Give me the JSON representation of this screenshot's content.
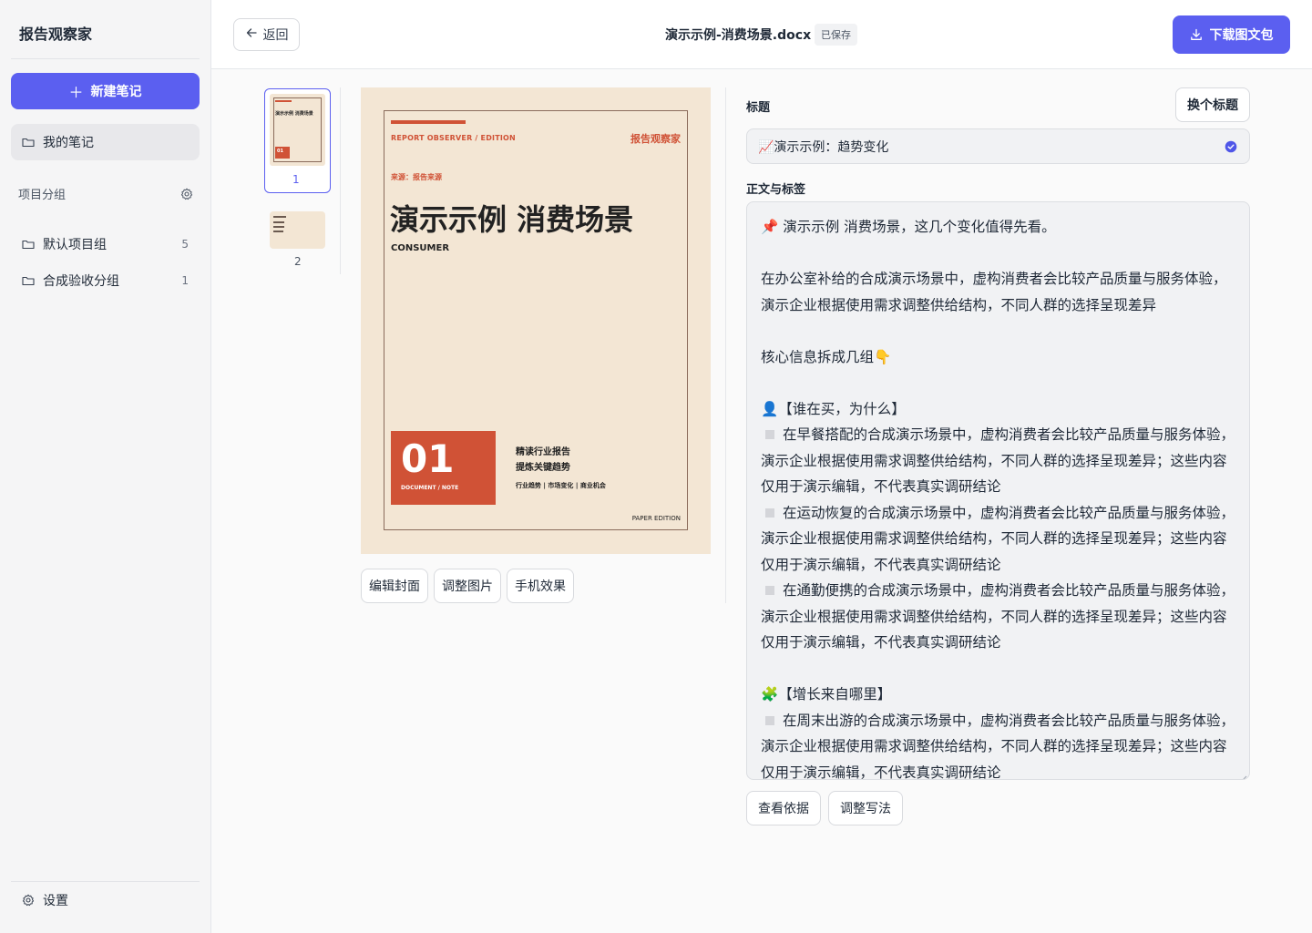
{
  "sidebar": {
    "brand": "报告观察家",
    "new_note": "新建笔记",
    "my_notes": "我的笔记",
    "groups_heading": "项目分组",
    "groups": [
      {
        "label": "默认项目组",
        "count": "5"
      },
      {
        "label": "合成验收分组",
        "count": "1"
      }
    ],
    "settings": "设置"
  },
  "header": {
    "back": "返回",
    "doc_title": "演示示例-消费场景.docx",
    "saved": "已保存",
    "download": "下载图文包"
  },
  "thumbnails": [
    {
      "number": "1",
      "mini_title": "演示示例 消费场景",
      "mini_num": "01"
    },
    {
      "number": "2"
    }
  ],
  "cover": {
    "edition": "REPORT OBSERVER / EDITION",
    "brand": "报告观察家",
    "source": "来源：报告来源",
    "title": "演示示例 消费场景",
    "subtitle": "CONSUMER",
    "number": "01",
    "doc_note": "DOCUMENT / NOTE",
    "tagline1": "精读行业报告",
    "tagline2": "提炼关键趋势",
    "keywords": "行业趋势 | 市场变化 | 商业机会",
    "paper": "PAPER EDITION"
  },
  "cover_actions": [
    "编辑封面",
    "调整图片",
    "手机效果"
  ],
  "editor": {
    "title_label": "标题",
    "swap_title": "换个标题",
    "title_value": "📈演示示例：趋势变化",
    "body_label": "正文与标签",
    "body_lines": [
      "📌 演示示例 消费场景，这几个变化值得先看。",
      "",
      "在办公室补给的合成演示场景中，虚构消费者会比较产品质量与服务体验，演示企业根据使用需求调整供给结构，不同人群的选择呈现差异",
      "",
      "核心信息拆成几组👇",
      "",
      "👤【谁在买，为什么】",
      "在早餐搭配的合成演示场景中，虚构消费者会比较产品质量与服务体验，演示企业根据使用需求调整供给结构，不同人群的选择呈现差异；这些内容仅用于演示编辑，不代表真实调研结论",
      "在运动恢复的合成演示场景中，虚构消费者会比较产品质量与服务体验，演示企业根据使用需求调整供给结构，不同人群的选择呈现差异；这些内容仅用于演示编辑，不代表真实调研结论",
      "在通勤便携的合成演示场景中，虚构消费者会比较产品质量与服务体验，演示企业根据使用需求调整供给结构，不同人群的选择呈现差异；这些内容仅用于演示编辑，不代表真实调研结论",
      "",
      "🧩【增长来自哪里】",
      "在周末出游的合成演示场景中，虚构消费者会比较产品质量与服务体验，演示企业根据使用需求调整供给结构，不同人群的选择呈现差异；这些内容仅用于演示编辑，不代表真实调研结论"
    ],
    "actions": [
      "查看依据",
      "调整写法"
    ]
  },
  "colors": {
    "accent": "#5b5ff0",
    "cover_red": "#d05236",
    "cover_bg": "#f3e6d4"
  }
}
